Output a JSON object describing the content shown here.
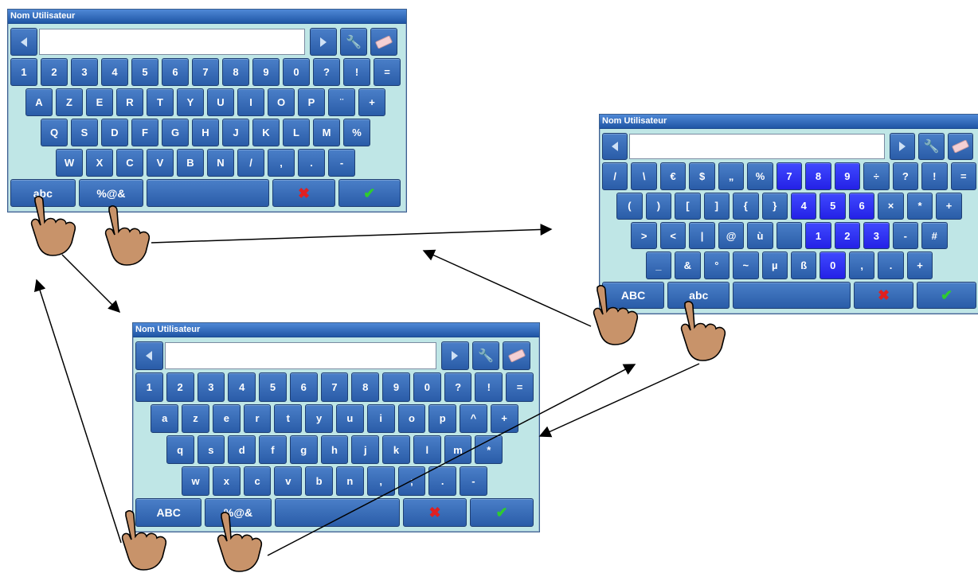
{
  "window_title": "Nom Utilisateur",
  "icons": {
    "left": "arrow-left-icon",
    "right": "arrow-right-icon",
    "tool": "tool-icon",
    "eraser": "eraser-icon",
    "cancel": "cross-icon",
    "ok": "check-icon",
    "hand": "hand-pointer-icon"
  },
  "colors": {
    "title_bar": "#1f55a5",
    "key": "#2a5ca8",
    "key_highlight": "#2421e6",
    "panel_bg": "#bfe6e6",
    "cancel": "#e02020",
    "ok": "#2ecc2e"
  },
  "keyboards": {
    "upper": {
      "row1": [
        "1",
        "2",
        "3",
        "4",
        "5",
        "6",
        "7",
        "8",
        "9",
        "0",
        "?",
        "!",
        "="
      ],
      "row2": [
        "A",
        "Z",
        "E",
        "R",
        "T",
        "Y",
        "U",
        "I",
        "O",
        "P",
        "¨",
        "+"
      ],
      "row3": [
        "Q",
        "S",
        "D",
        "F",
        "G",
        "H",
        "J",
        "K",
        "L",
        "M",
        "%"
      ],
      "row4": [
        "W",
        "X",
        "C",
        "V",
        "B",
        "N",
        "/",
        ",",
        ".",
        "-"
      ],
      "bottom": [
        "abc",
        "%@&"
      ]
    },
    "lower": {
      "row1": [
        "1",
        "2",
        "3",
        "4",
        "5",
        "6",
        "7",
        "8",
        "9",
        "0",
        "?",
        "!",
        "="
      ],
      "row2": [
        "a",
        "z",
        "e",
        "r",
        "t",
        "y",
        "u",
        "i",
        "o",
        "p",
        "^",
        "+"
      ],
      "row3": [
        "q",
        "s",
        "d",
        "f",
        "g",
        "h",
        "j",
        "k",
        "l",
        "m",
        "*"
      ],
      "row4": [
        "w",
        "x",
        "c",
        "v",
        "b",
        "n",
        ",",
        ";",
        ".",
        "-"
      ],
      "bottom": [
        "ABC",
        "%@&"
      ]
    },
    "symbols": {
      "row1": [
        "/",
        "\\",
        "€",
        "$",
        "„",
        "%",
        "7",
        "8",
        "9",
        "÷",
        "?",
        "!",
        "="
      ],
      "row2": [
        "(",
        ")",
        "[",
        "]",
        "{",
        "}",
        "4",
        "5",
        "6",
        "×",
        "*",
        "+"
      ],
      "row3": [
        ">",
        "<",
        "|",
        "@",
        "ù",
        "",
        "1",
        "2",
        "3",
        "-",
        "#"
      ],
      "row4": [
        "_",
        "&",
        "°",
        "~",
        "µ",
        "ß",
        "0",
        ",",
        ".",
        "+"
      ],
      "bottom": [
        "ABC",
        "abc"
      ]
    }
  }
}
